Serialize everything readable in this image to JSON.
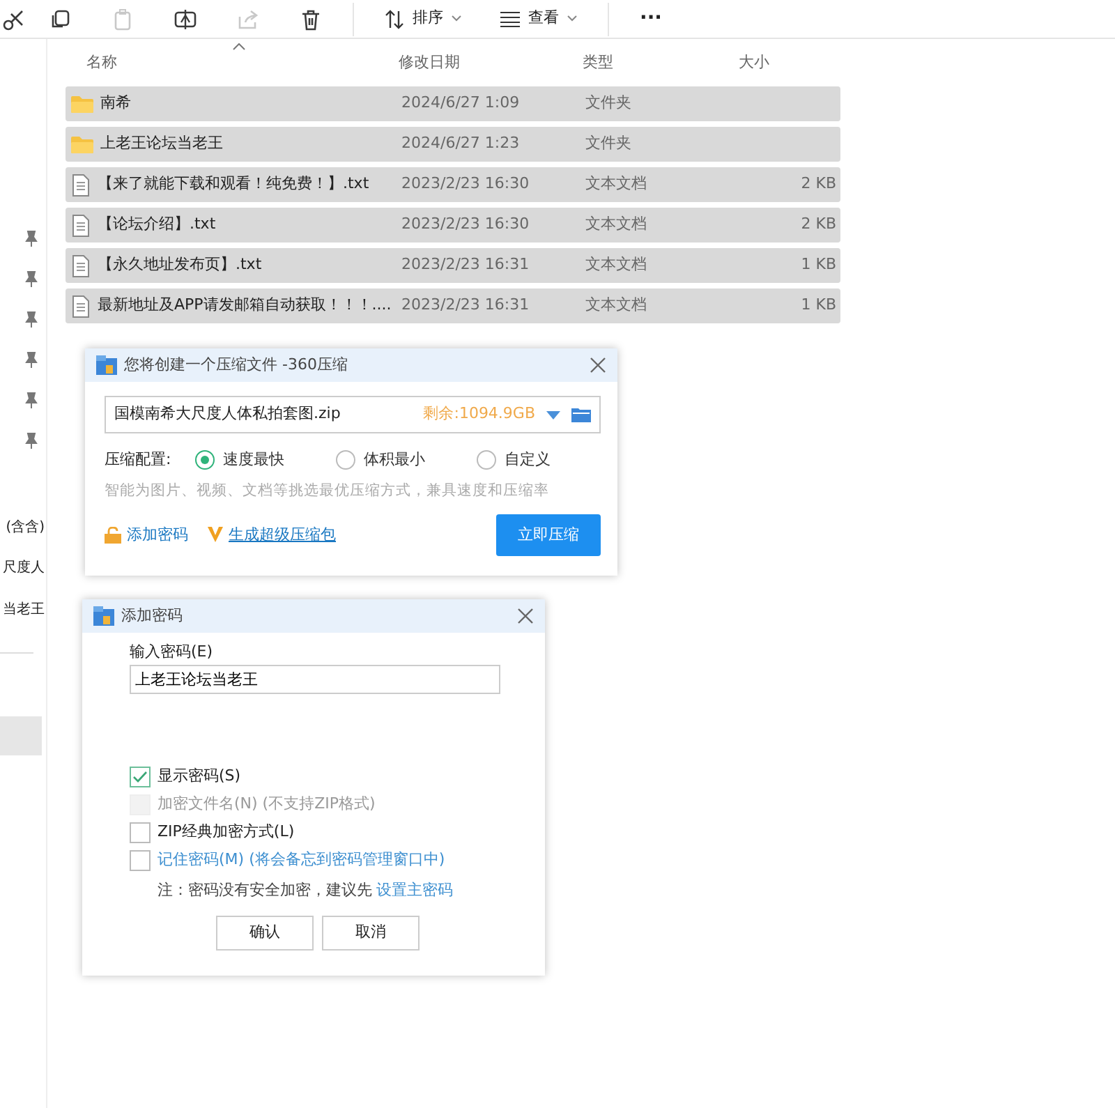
{
  "toolbar": {
    "items": [
      {
        "kind": "cut",
        "disabled": false
      },
      {
        "kind": "copy",
        "disabled": false
      },
      {
        "kind": "paste",
        "disabled": true
      },
      {
        "kind": "rename",
        "disabled": false
      },
      {
        "kind": "share",
        "disabled": true
      },
      {
        "kind": "delete",
        "disabled": false
      }
    ],
    "sort": "排序",
    "view": "查看",
    "more": "···"
  },
  "sidebar": {
    "labels": [
      "(含含)",
      "尺度人",
      "当老王"
    ]
  },
  "file_list": {
    "columns": [
      "名称",
      "修改日期",
      "类型",
      "大小"
    ],
    "rows": [
      {
        "kind": "folder",
        "name": "南希",
        "date": "2024/6/27 1:09",
        "type": "文件夹",
        "size": "",
        "selected": true
      },
      {
        "kind": "folder",
        "name": "上老王论坛当老王",
        "date": "2024/6/27 1:23",
        "type": "文件夹",
        "size": "",
        "selected": true
      },
      {
        "kind": "text",
        "name": "【来了就能下载和观看！纯免费！】.txt",
        "date": "2023/2/23 16:30",
        "type": "文本文档",
        "size": "2 KB",
        "selected": true
      },
      {
        "kind": "text",
        "name": "【论坛介绍】.txt",
        "date": "2023/2/23 16:30",
        "type": "文本文档",
        "size": "2 KB",
        "selected": true
      },
      {
        "kind": "text",
        "name": "【永久地址发布页】.txt",
        "date": "2023/2/23 16:31",
        "type": "文本文档",
        "size": "1 KB",
        "selected": true
      },
      {
        "kind": "text",
        "name": "最新地址及APP请发邮箱自动获取！！！....",
        "date": "2023/2/23 16:31",
        "type": "文本文档",
        "size": "1 KB",
        "selected": true
      }
    ]
  },
  "compress_dialog": {
    "title": "您将创建一个压缩文件 -360压缩",
    "filename": "国模南希大尺度人体私拍套图.zip",
    "free_space": "剩余:1094.9GB",
    "config_label": "压缩配置:",
    "options": [
      {
        "label": "速度最快",
        "selected": true
      },
      {
        "label": "体积最小",
        "selected": false
      },
      {
        "label": "自定义",
        "selected": false
      }
    ],
    "hint": "智能为图片、视频、文档等挑选最优压缩方式，兼具速度和压缩率",
    "add_password": "添加密码",
    "super_pack": "生成超级压缩包",
    "compress_button": "立即压缩"
  },
  "password_dialog": {
    "title": "添加密码",
    "field_label": "输入密码(E)",
    "password": "上老王论坛当老王",
    "options": [
      {
        "label": "显示密码(S)",
        "checked": true,
        "disabled": false,
        "kind": "plain"
      },
      {
        "label": "加密文件名(N) (不支持ZIP格式)",
        "checked": false,
        "disabled": true,
        "kind": "plain"
      },
      {
        "label": "ZIP经典加密方式(L)",
        "checked": false,
        "disabled": false,
        "kind": "plain"
      },
      {
        "label": "记住密码(M) (将会备忘到密码管理窗口中)",
        "checked": false,
        "disabled": false,
        "kind": "link"
      }
    ],
    "note": "注：密码没有安全加密，建议先",
    "note_link": "设置主密码",
    "ok": "确认",
    "cancel": "取消"
  }
}
